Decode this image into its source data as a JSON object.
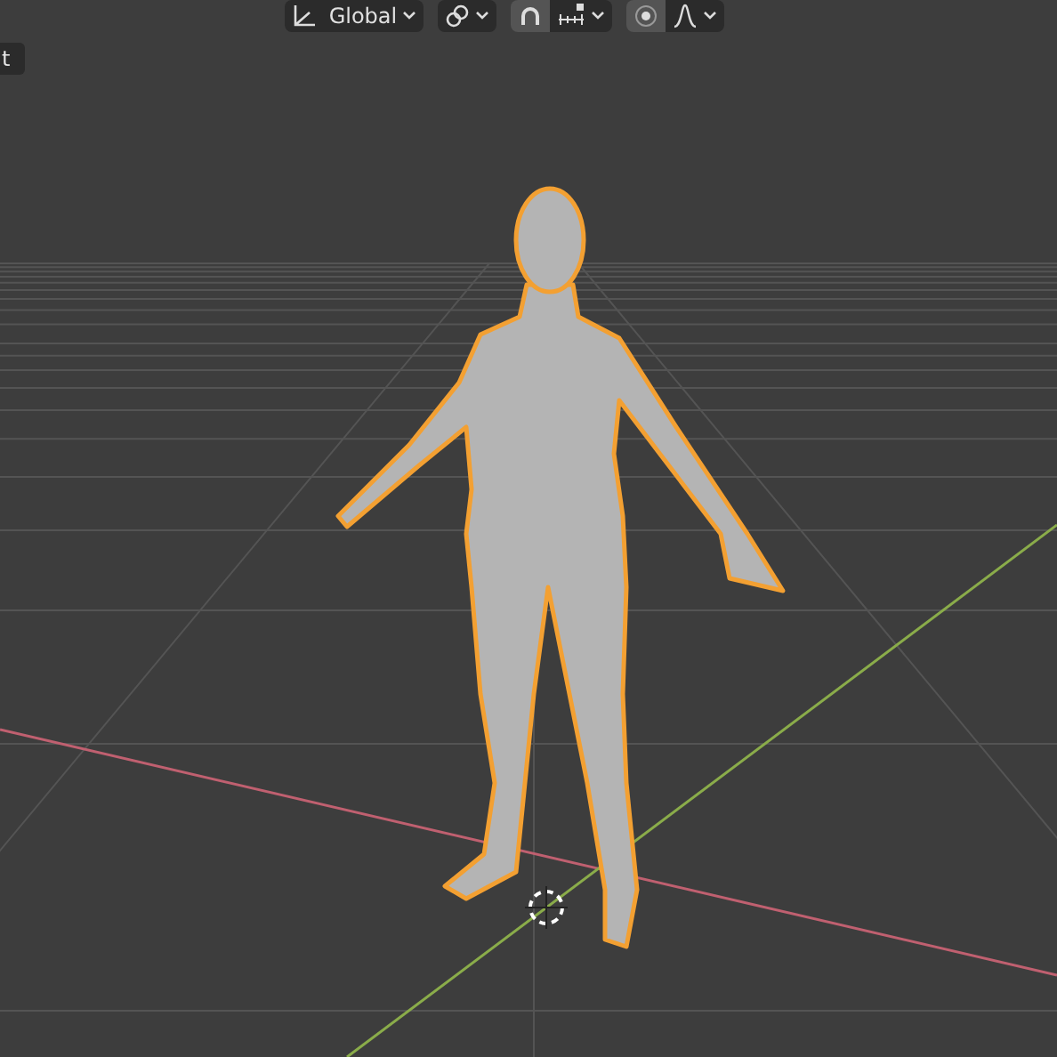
{
  "header": {
    "transform_orientation": {
      "value": "Global"
    }
  },
  "side_tab": {
    "label": "t"
  }
}
